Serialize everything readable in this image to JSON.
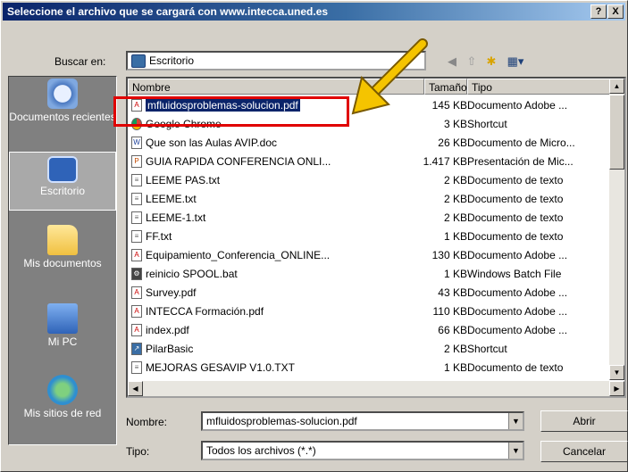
{
  "window": {
    "title": "Seleccione el archivo que se cargará con www.intecca.uned.es",
    "help": "?",
    "close": "X"
  },
  "lookin": {
    "label": "Buscar en:",
    "value": "Escritorio"
  },
  "places": [
    {
      "label": "Documentos recientes",
      "icon": "recent-documents-icon"
    },
    {
      "label": "Escritorio",
      "icon": "desktop-icon"
    },
    {
      "label": "Mis documentos",
      "icon": "my-documents-icon"
    },
    {
      "label": "Mi PC",
      "icon": "my-computer-icon"
    },
    {
      "label": "Mis sitios de red",
      "icon": "network-places-icon"
    }
  ],
  "columns": {
    "name": "Nombre",
    "size": "Tamaño",
    "type": "Tipo"
  },
  "files": [
    {
      "name": "mfluidosproblemas-solucion.pdf",
      "size": "145 KB",
      "type": "Documento Adobe ...",
      "icon": "pdf-icon"
    },
    {
      "name": "Google Chrome",
      "size": "3 KB",
      "type": "Shortcut",
      "icon": "chrome-icon"
    },
    {
      "name": "Que son las Aulas AVIP.doc",
      "size": "26 KB",
      "type": "Documento de Micro...",
      "icon": "word-icon"
    },
    {
      "name": "GUIA RAPIDA CONFERENCIA ONLI...",
      "size": "1.417 KB",
      "type": "Presentación de Mic...",
      "icon": "ppt-icon"
    },
    {
      "name": "LEEME PAS.txt",
      "size": "2 KB",
      "type": "Documento de texto",
      "icon": "txt-icon"
    },
    {
      "name": "LEEME.txt",
      "size": "2 KB",
      "type": "Documento de texto",
      "icon": "txt-icon"
    },
    {
      "name": "LEEME-1.txt",
      "size": "2 KB",
      "type": "Documento de texto",
      "icon": "txt-icon"
    },
    {
      "name": "FF.txt",
      "size": "1 KB",
      "type": "Documento de texto",
      "icon": "txt-icon"
    },
    {
      "name": "Equipamiento_Conferencia_ONLINE...",
      "size": "130 KB",
      "type": "Documento Adobe ...",
      "icon": "pdf-icon"
    },
    {
      "name": "reinicio SPOOL.bat",
      "size": "1 KB",
      "type": "Windows Batch File",
      "icon": "bat-icon"
    },
    {
      "name": "Survey.pdf",
      "size": "43 KB",
      "type": "Documento Adobe ...",
      "icon": "pdf-icon"
    },
    {
      "name": "INTECCA Formación.pdf",
      "size": "110 KB",
      "type": "Documento Adobe ...",
      "icon": "pdf-icon"
    },
    {
      "name": "index.pdf",
      "size": "66 KB",
      "type": "Documento Adobe ...",
      "icon": "pdf-icon"
    },
    {
      "name": "PilarBasic",
      "size": "2 KB",
      "type": "Shortcut",
      "icon": "shortcut-icon"
    },
    {
      "name": "MEJORAS GESAVIP V1.0.TXT",
      "size": "1 KB",
      "type": "Documento de texto",
      "icon": "txt-icon"
    }
  ],
  "filename": {
    "label": "Nombre:",
    "value": "mfluidosproblemas-solucion.pdf"
  },
  "filetype": {
    "label": "Tipo:",
    "value": "Todos los archivos (*.*)"
  },
  "buttons": {
    "open": "Abrir",
    "cancel": "Cancelar"
  },
  "colors": {
    "highlight_box": "#e00000",
    "arrow": "#f5c400",
    "selection": "#0a246a"
  }
}
